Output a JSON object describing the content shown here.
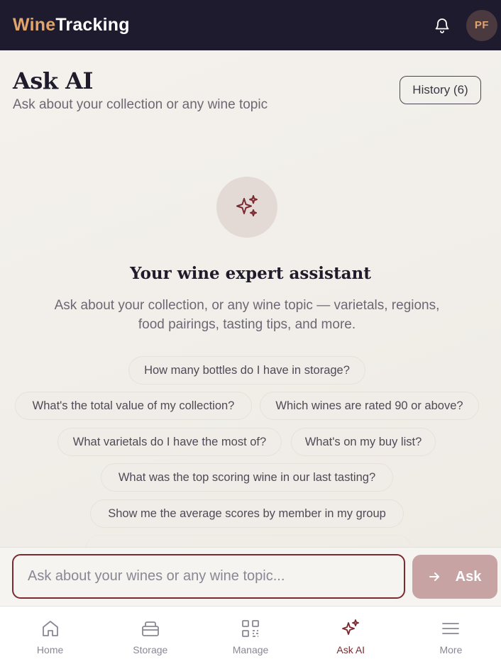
{
  "header": {
    "brand_part1": "Wine",
    "brand_part2": "Tracking",
    "avatar_initials": "PF",
    "notification_icon": "bell-icon"
  },
  "page": {
    "title": "Ask AI",
    "subtitle": "Ask about your collection or any wine topic",
    "history_label": "History (6)"
  },
  "hero": {
    "icon": "sparkles-icon",
    "title": "Your wine expert assistant",
    "description_line1": "Ask about your collection, or any wine topic — varietals, regions,",
    "description_line2": "food pairings, tasting tips, and more."
  },
  "suggestions": [
    "How many bottles do I have in storage?",
    "What's the total value of my collection?",
    "Which wines are rated 90 or above?",
    "What varietals do I have the most of?",
    "What's on my buy list?",
    "What was the top scoring wine in our last tasting?",
    "Show me the average scores by member in my group"
  ],
  "composer": {
    "placeholder": "Ask about your wines or any wine topic...",
    "value": "",
    "ask_label": "Ask"
  },
  "nav": {
    "items": [
      {
        "label": "Home",
        "icon": "home-icon"
      },
      {
        "label": "Storage",
        "icon": "storage-icon"
      },
      {
        "label": "Manage",
        "icon": "qr-code-icon"
      },
      {
        "label": "Ask AI",
        "icon": "sparkles-icon"
      },
      {
        "label": "More",
        "icon": "menu-icon"
      }
    ],
    "active": "Ask AI"
  },
  "colors": {
    "header_bg": "#1e1b2e",
    "brand_accent": "#e0a46c",
    "wine_accent": "#7a2a30",
    "ask_button": "#c7a3a4"
  }
}
